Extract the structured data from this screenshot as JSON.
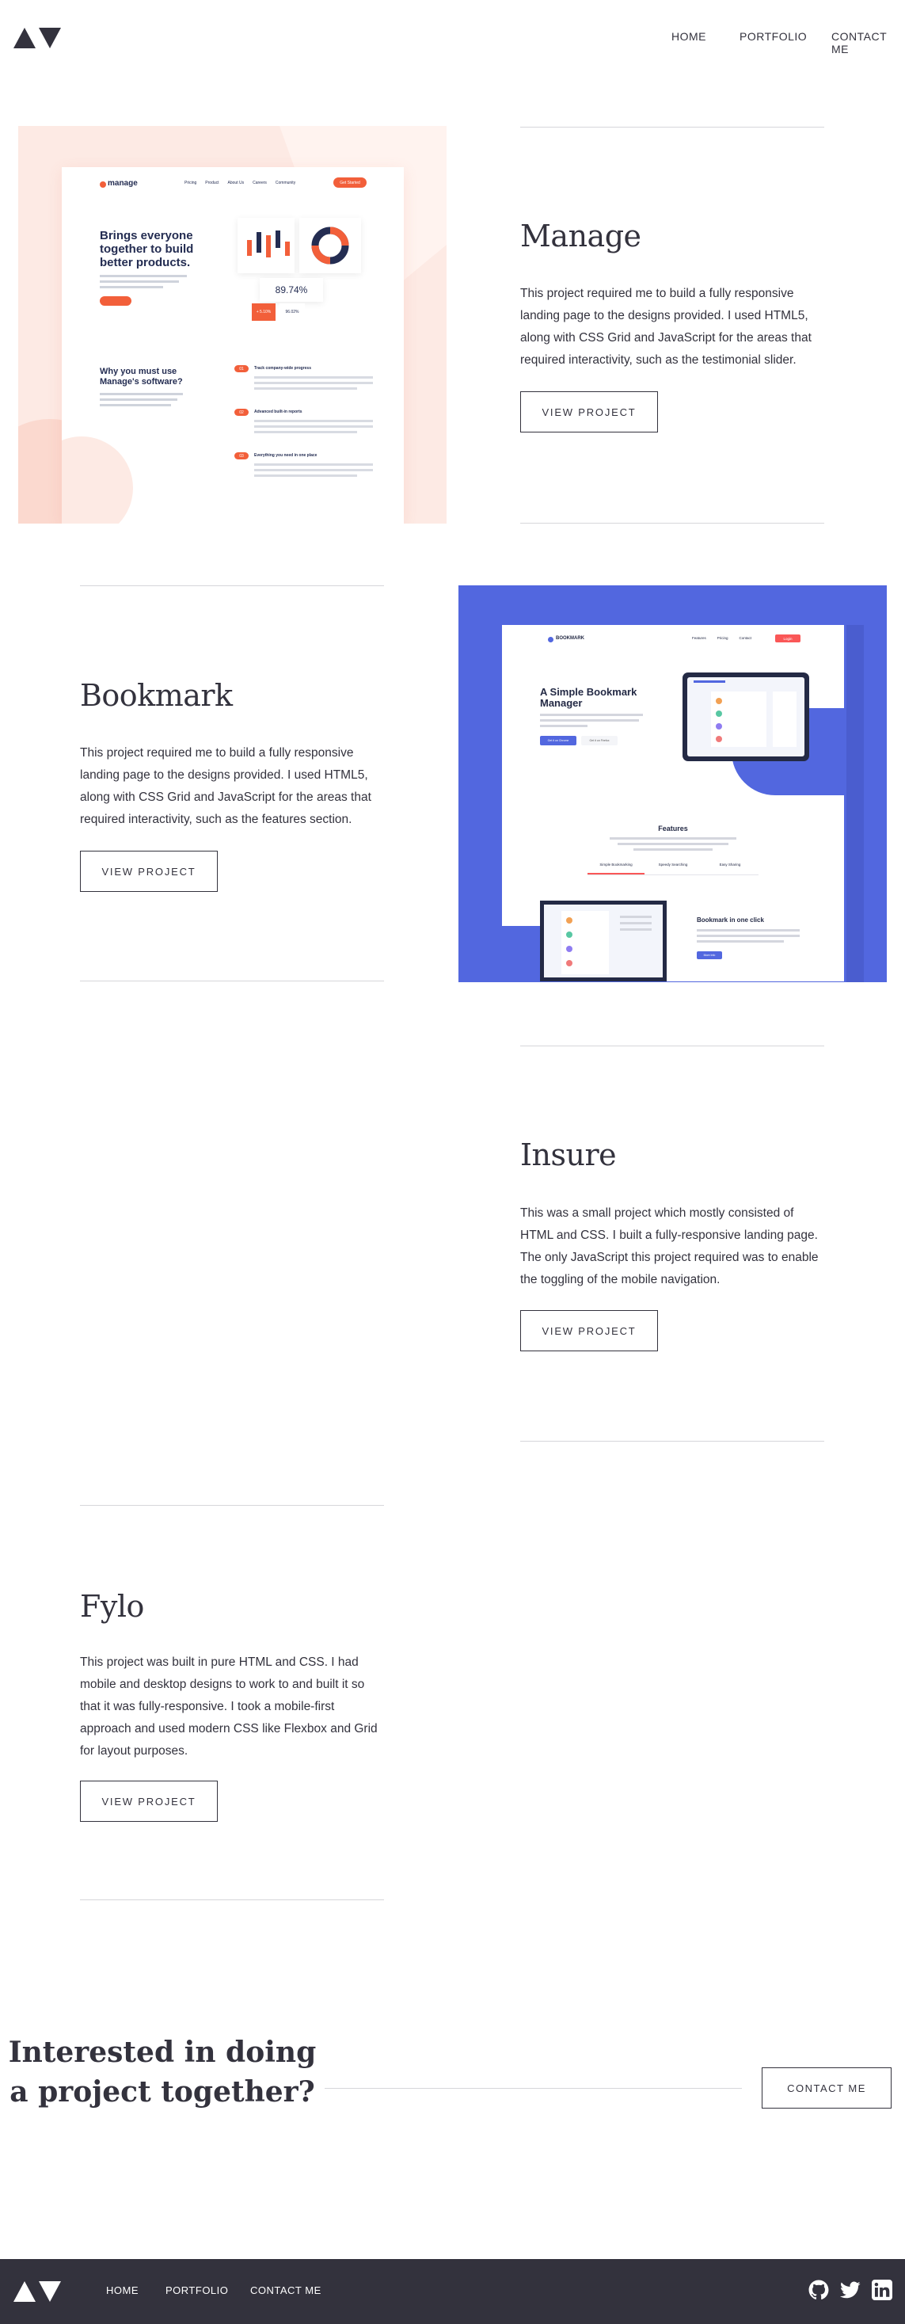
{
  "nav": {
    "home": "HOME",
    "portfolio": "PORTFOLIO",
    "contact": "CONTACT ME"
  },
  "projects": [
    {
      "title": "Manage",
      "description": "This project required me to build a fully responsive landing page to the designs provided. I used HTML5, along with CSS Grid and JavaScript for the areas that required interactivity, such as the testimonial slider.",
      "button": "VIEW PROJECT"
    },
    {
      "title": "Bookmark",
      "description": "This project required me to build a fully responsive landing page to the designs provided. I used HTML5, along with CSS Grid and JavaScript for the areas that required interactivity, such as the features section.",
      "button": "VIEW PROJECT"
    },
    {
      "title": "Insure",
      "description": "This was a small project which mostly consisted of HTML and CSS. I built a fully-responsive landing page. The only JavaScript this project required was to enable the toggling of the mobile navigation.",
      "button": "VIEW PROJECT"
    },
    {
      "title": "Fylo",
      "description": "This project was built in pure HTML and CSS. I had mobile and desktop designs to work to and built it so that it was fully-responsive. I took a mobile-first approach and used modern CSS like Flexbox and Grid for layout purposes.",
      "button": "VIEW PROJECT"
    }
  ],
  "manage_preview": {
    "logo": "manage",
    "nav": [
      "Pricing",
      "Product",
      "About Us",
      "Careers",
      "Community"
    ],
    "cta": "Get Started",
    "headline": "Brings everyone together to build better products.",
    "stat": "89.74%",
    "small_stats": [
      "+ 5.10%",
      "96.02%"
    ],
    "subhead": "Why you must use Manage's software?",
    "features": [
      {
        "num": "01",
        "title": "Track company-wide progress"
      },
      {
        "num": "02",
        "title": "Advanced built-in reports"
      },
      {
        "num": "03",
        "title": "Everything you need in one place"
      }
    ]
  },
  "bookmark_preview": {
    "logo": "BOOKMARK",
    "nav": [
      "Features",
      "Pricing",
      "Contact",
      "Login"
    ],
    "headline": "A Simple Bookmark Manager",
    "buttons": [
      "Get it on Chrome",
      "Get it on Firefox"
    ],
    "features_title": "Features",
    "tabs": [
      "Simple Bookmarking",
      "Speedy Searching",
      "Easy Sharing"
    ],
    "panel_title": "Bookmark in one click",
    "panel_button": "More Info"
  },
  "cta": {
    "title": "Interested in doing a project together?",
    "button": "CONTACT ME"
  },
  "footer": {
    "home": "HOME",
    "portfolio": "PORTFOLIO",
    "contact": "CONTACT ME",
    "icons": [
      "github-icon",
      "twitter-icon",
      "linkedin-icon"
    ]
  },
  "colors": {
    "dark": "#33323d",
    "manage_accent": "#f25f3a",
    "manage_bg": "#fdeae4",
    "bookmark_blue": "#5267df",
    "bookmark_red": "#fa5757",
    "rule": "#d6d6da"
  }
}
